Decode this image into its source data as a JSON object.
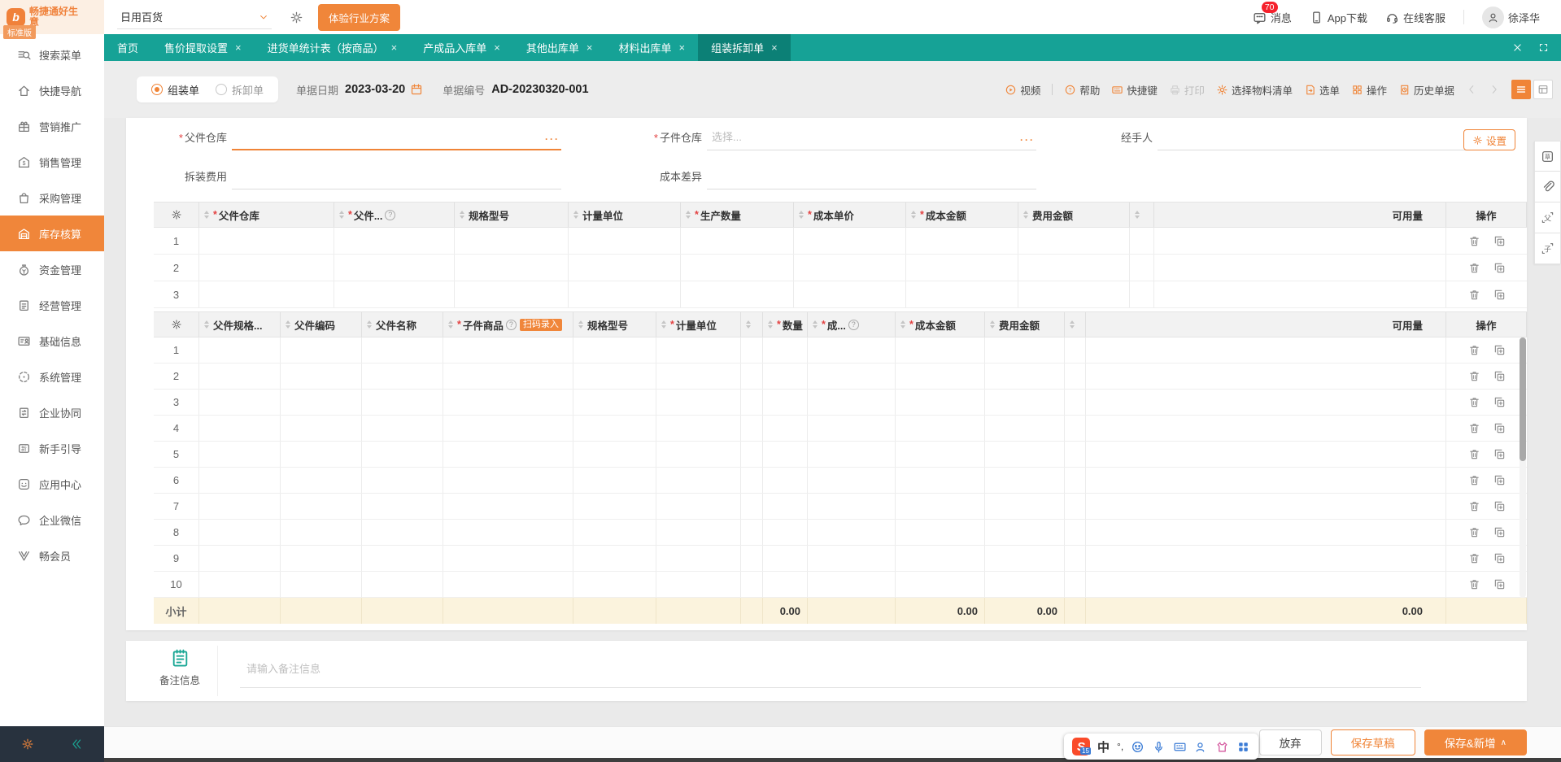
{
  "header": {
    "logo_title": "畅捷通好生意",
    "logo_badge": "标准版",
    "org_name": "日用百货",
    "trial_button": "体验行业方案",
    "messages_label": "消息",
    "messages_badge": "70",
    "app_download_label": "App下载",
    "online_service_label": "在线客服",
    "username": "徐泽华"
  },
  "tabs": [
    {
      "label": "首页",
      "closable": false,
      "active": false
    },
    {
      "label": "售价提取设置",
      "closable": true,
      "active": false
    },
    {
      "label": "进货单统计表（按商品）",
      "closable": true,
      "active": false
    },
    {
      "label": "产成品入库单",
      "closable": true,
      "active": false
    },
    {
      "label": "其他出库单",
      "closable": true,
      "active": false
    },
    {
      "label": "材料出库单",
      "closable": true,
      "active": false
    },
    {
      "label": "组装拆卸单",
      "closable": true,
      "active": true
    }
  ],
  "sidebar": [
    {
      "label": "搜索菜单",
      "icon": "search",
      "active": false
    },
    {
      "label": "快捷导航",
      "icon": "home",
      "active": false
    },
    {
      "label": "营销推广",
      "icon": "gift",
      "active": false
    },
    {
      "label": "销售管理",
      "icon": "sale",
      "active": false
    },
    {
      "label": "采购管理",
      "icon": "bag",
      "active": false
    },
    {
      "label": "库存核算",
      "icon": "warehouse",
      "active": true
    },
    {
      "label": "资金管理",
      "icon": "money",
      "active": false
    },
    {
      "label": "经营管理",
      "icon": "clipboard",
      "active": false
    },
    {
      "label": "基础信息",
      "icon": "idcard",
      "active": false
    },
    {
      "label": "系统管理",
      "icon": "system",
      "active": false
    },
    {
      "label": "企业协同",
      "icon": "collab",
      "active": false
    },
    {
      "label": "新手引导",
      "icon": "guide",
      "active": false
    },
    {
      "label": "应用中心",
      "icon": "apps",
      "active": false
    },
    {
      "label": "企业微信",
      "icon": "wechat",
      "active": false
    },
    {
      "label": "畅会员",
      "icon": "vip",
      "active": false
    }
  ],
  "doc": {
    "type_options": [
      {
        "label": "组装单",
        "selected": true
      },
      {
        "label": "拆卸单",
        "selected": false
      }
    ],
    "date_label": "单据日期",
    "date_value": "2023-03-20",
    "no_label": "单据编号",
    "no_value": "AD-20230320-001",
    "toolbar": [
      {
        "label": "视频",
        "icon": "video",
        "disabled": false
      },
      {
        "label": "帮助",
        "icon": "help",
        "disabled": false,
        "divider_before": true
      },
      {
        "label": "快捷键",
        "icon": "hotkey",
        "disabled": false
      },
      {
        "label": "打印",
        "icon": "print",
        "disabled": true
      },
      {
        "label": "选择物料清单",
        "icon": "material",
        "disabled": false
      },
      {
        "label": "选单",
        "icon": "pick",
        "disabled": false
      },
      {
        "label": "操作",
        "icon": "ops",
        "disabled": false
      },
      {
        "label": "历史单据",
        "icon": "history",
        "disabled": false
      }
    ]
  },
  "form": {
    "parent_wh": {
      "label": "父件仓库",
      "required": true,
      "value": ""
    },
    "child_wh": {
      "label": "子件仓库",
      "required": true,
      "placeholder": "选择..."
    },
    "handler": {
      "label": "经手人",
      "value": ""
    },
    "settings_button": "设置",
    "fee": {
      "label": "拆装费用",
      "value": ""
    },
    "cost_diff": {
      "label": "成本差异",
      "value": ""
    }
  },
  "parent_table": {
    "columns": [
      {
        "label": "父件仓库",
        "required": true
      },
      {
        "label": "父件...",
        "required": true,
        "help": true
      },
      {
        "label": "规格型号"
      },
      {
        "label": "计量单位"
      },
      {
        "label": "生产数量",
        "required": true
      },
      {
        "label": "成本单价",
        "required": true
      },
      {
        "label": "成本金额",
        "required": true
      },
      {
        "label": "费用金额"
      },
      {
        "label": "",
        "sort_only": true
      }
    ],
    "available_label": "可用量",
    "ops_label": "操作",
    "rows": [
      "1",
      "2",
      "3"
    ]
  },
  "child_table": {
    "columns": [
      {
        "label": "父件规格..."
      },
      {
        "label": "父件编码"
      },
      {
        "label": "父件名称"
      },
      {
        "label": "子件商品",
        "required": true,
        "help": true,
        "badge": "扫码录入"
      },
      {
        "label": "规格型号"
      },
      {
        "label": "计量单位",
        "required": true
      },
      {
        "label": "",
        "sort_only": true
      },
      {
        "label": "数量",
        "required": true,
        "subtotal": "0.00"
      },
      {
        "label": "成...",
        "required": true,
        "help": true
      },
      {
        "label": "成本金额",
        "required": true,
        "subtotal": "0.00"
      },
      {
        "label": "费用金额",
        "subtotal": "0.00"
      },
      {
        "label": "",
        "sort_only": true
      }
    ],
    "available_label": "可用量",
    "ops_label": "操作",
    "rows": [
      "1",
      "2",
      "3",
      "4",
      "5",
      "6",
      "7",
      "8",
      "9",
      "10"
    ],
    "subtotal_label": "小计",
    "available_subtotal": "0.00"
  },
  "remark": {
    "label": "备注信息",
    "placeholder": "请输入备注信息"
  },
  "footer": {
    "discard": "放弃",
    "save_draft": "保存草稿",
    "save_new": "保存&新增"
  },
  "rail_icons": [
    "draft-note",
    "paperclip",
    "select-parent",
    "select-child"
  ],
  "ime": {
    "mode": "中",
    "contacts_badge": "15"
  },
  "colors": {
    "accent": "#f0863a",
    "teal": "#16a296",
    "teal_dark": "#0c8076",
    "badge_red": "#f5222d",
    "subtotal_bg": "#fbf3dd"
  }
}
